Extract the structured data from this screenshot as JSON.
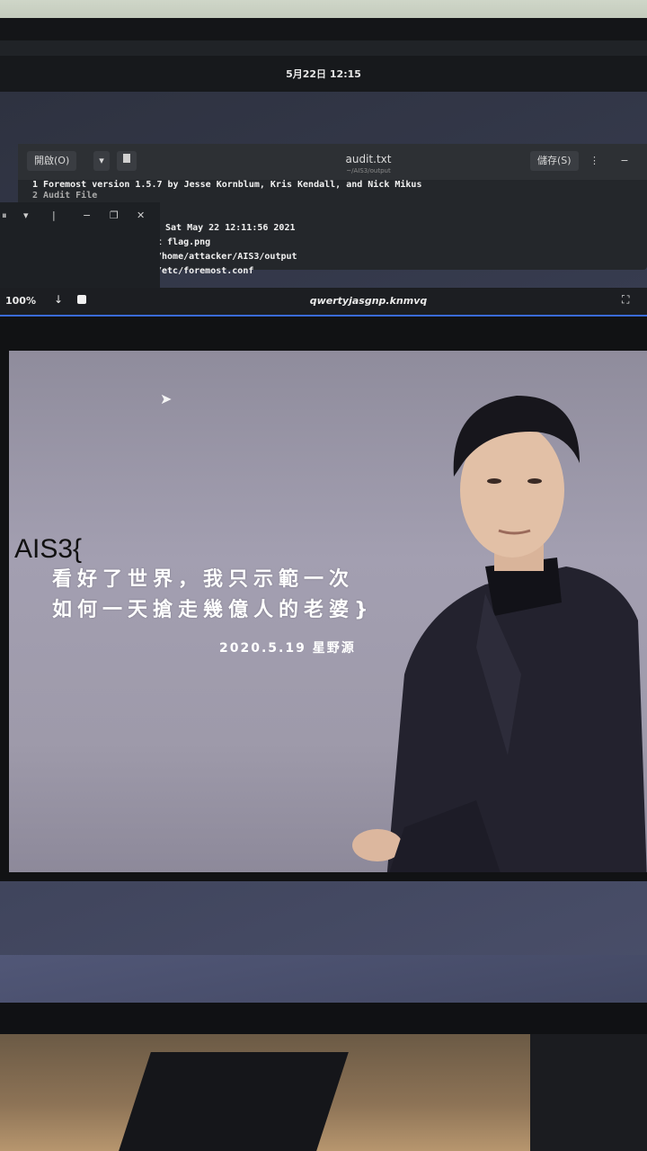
{
  "topbar": {
    "clock": "5月22日 12:15"
  },
  "editor": {
    "open_label": "開啟(O)",
    "open_arrow": "▾",
    "pin_icon": "document-pin-icon",
    "title": "audit.txt",
    "subtitle": "~/AIS3/output",
    "save_label": "儲存(S)",
    "menu_icon": "⋮",
    "minimize_icon": "−",
    "lines": [
      "1 Foremost version 1.5.7 by Jesse Kornblum, Kris Kendall, and Nick Mikus",
      "2 Audit File",
      "Sat May 22 12:11:56 2021",
      "t flag.png",
      "/home/attacker/AIS3/output",
      " /etc/foremost.conf"
    ]
  },
  "terminal": {
    "buttons": [
      "⏸",
      "▾",
      "|",
      "−",
      "❐",
      "✕"
    ]
  },
  "viewer": {
    "zoom": "100%",
    "title": "qwertyjasgnp.knmvq",
    "download_icon": "↓",
    "expand_icon": "⛶"
  },
  "image": {
    "flag_prefix": "AIS3{",
    "line1": "看好了世界，我只示範一次",
    "line2": "如何一天搶走幾億人的老婆}",
    "signature": "2020.5.19 星野源"
  }
}
